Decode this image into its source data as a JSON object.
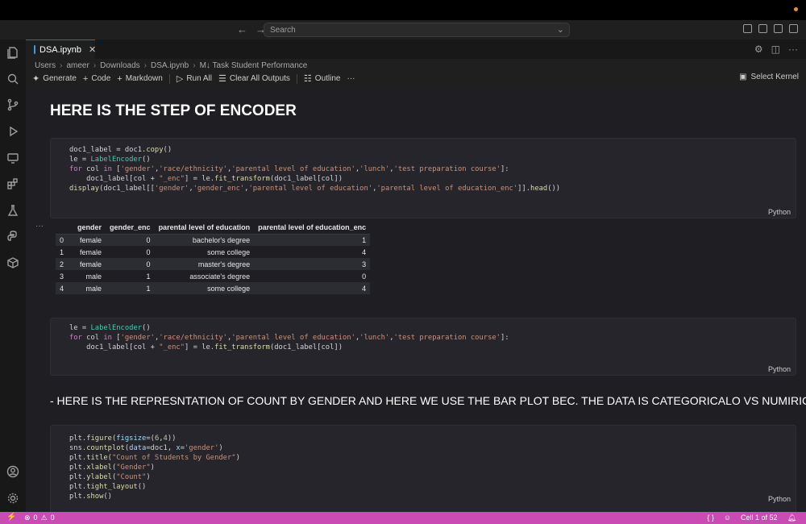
{
  "window": {
    "search_placeholder": "Search"
  },
  "tab": {
    "label": "DSA.ipynb",
    "close": "✕"
  },
  "breadcrumb": {
    "items": [
      "Users",
      "ameer",
      "Downloads",
      "DSA.ipynb",
      "M↓ Task Student Performance"
    ],
    "separator": "›"
  },
  "toolbar": {
    "generate": "Generate",
    "code": "Code",
    "markdown": "Markdown",
    "run_all": "Run All",
    "clear_all": "Clear All Outputs",
    "outline": "Outline",
    "more": "···",
    "select_kernel": "Select Kernel"
  },
  "cells": {
    "heading1": "HERE IS THE STEP OF ENCODER",
    "heading2": "- HERE IS THE REPRESNTATION OF COUNT BY GENDER AND HERE WE USE THE BAR PLOT BEC. THE DATA IS CATEGORICALO VS NUMIRIC",
    "language": "Python",
    "output_menu": "···"
  },
  "dataframe": {
    "columns": [
      "",
      "gender",
      "gender_enc",
      "parental level of education",
      "parental level of education_enc"
    ],
    "rows": [
      [
        "0",
        "female",
        "0",
        "bachelor's degree",
        "1"
      ],
      [
        "1",
        "female",
        "0",
        "some college",
        "4"
      ],
      [
        "2",
        "female",
        "0",
        "master's degree",
        "3"
      ],
      [
        "3",
        "male",
        "1",
        "associate's degree",
        "0"
      ],
      [
        "4",
        "male",
        "1",
        "some college",
        "4"
      ]
    ]
  },
  "statusbar": {
    "errors": "0",
    "warnings": "0",
    "cell_position": "Cell 1 of 52",
    "braces": "{ }"
  },
  "colors": {
    "statusbar": "#c94bb3",
    "accent": "#0078d4"
  }
}
